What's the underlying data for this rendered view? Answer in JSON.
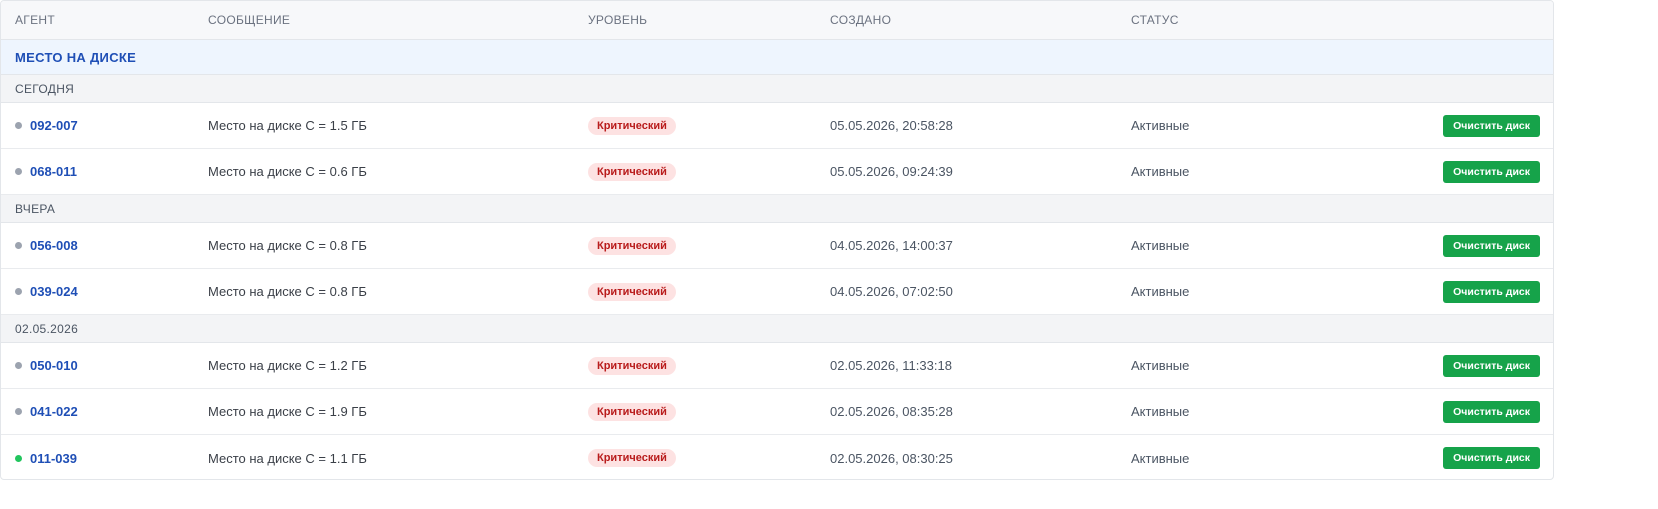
{
  "columns": {
    "agent": "АГЕНТ",
    "message": "СООБЩЕНИЕ",
    "level": "УРОВЕНЬ",
    "created": "СОЗДАНО",
    "status": "СТАТУС"
  },
  "group": {
    "title": "МЕСТО НА ДИСКЕ"
  },
  "action_label": "Очистить диск",
  "sections": [
    {
      "label": "СЕГОДНЯ",
      "rows": [
        {
          "agent": "092-007",
          "online": false,
          "message": "Место на диске C = 1.5 ГБ",
          "level": "Критический",
          "created": "05.05.2026, 20:58:28",
          "status": "Активные"
        },
        {
          "agent": "068-011",
          "online": false,
          "message": "Место на диске C = 0.6 ГБ",
          "level": "Критический",
          "created": "05.05.2026, 09:24:39",
          "status": "Активные"
        }
      ]
    },
    {
      "label": "ВЧЕРА",
      "rows": [
        {
          "agent": "056-008",
          "online": false,
          "message": "Место на диске C = 0.8 ГБ",
          "level": "Критический",
          "created": "04.05.2026, 14:00:37",
          "status": "Активные"
        },
        {
          "agent": "039-024",
          "online": false,
          "message": "Место на диске C = 0.8 ГБ",
          "level": "Критический",
          "created": "04.05.2026, 07:02:50",
          "status": "Активные"
        }
      ]
    },
    {
      "label": "02.05.2026",
      "rows": [
        {
          "agent": "050-010",
          "online": false,
          "message": "Место на диске C = 1.2 ГБ",
          "level": "Критический",
          "created": "02.05.2026, 11:33:18",
          "status": "Активные"
        },
        {
          "agent": "041-022",
          "online": false,
          "message": "Место на диске C = 1.9 ГБ",
          "level": "Критический",
          "created": "02.05.2026, 08:35:28",
          "status": "Активные"
        },
        {
          "agent": "011-039",
          "online": true,
          "message": "Место на диске C = 1.1 ГБ",
          "level": "Критический",
          "created": "02.05.2026, 08:30:25",
          "status": "Активные"
        }
      ]
    }
  ],
  "colors": {
    "accent": "#1f4fb6",
    "action": "#16a34a",
    "critical_bg": "#fde2e2",
    "critical_text": "#b91c1c",
    "dot_offline": "#9ca3af",
    "dot_online": "#22c55e"
  }
}
